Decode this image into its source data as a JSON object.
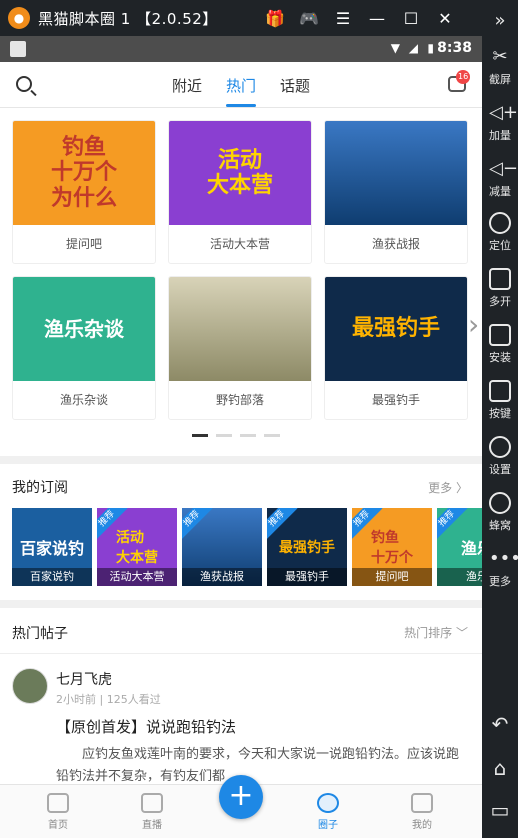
{
  "window": {
    "title": "黑猫脚本圈 1 【2.0.52】",
    "controls": [
      "☰",
      "—",
      "☐",
      "✕"
    ]
  },
  "sidebar": {
    "items": [
      {
        "label": "截屏",
        "icon": "scissors-icon"
      },
      {
        "label": "加量",
        "icon": "volume-up-icon"
      },
      {
        "label": "减量",
        "icon": "volume-down-icon"
      },
      {
        "label": "定位",
        "icon": "location-icon"
      },
      {
        "label": "多开",
        "icon": "multi-window-icon"
      },
      {
        "label": "安装",
        "icon": "apk-install-icon"
      },
      {
        "label": "按键",
        "icon": "keyboard-icon"
      },
      {
        "label": "设置",
        "icon": "gear-icon"
      },
      {
        "label": "蜂窝",
        "icon": "cellular-icon"
      },
      {
        "label": "更多",
        "icon": "more-icon"
      }
    ]
  },
  "statusbar": {
    "time": "8:38"
  },
  "topnav": {
    "tabs": [
      {
        "label": "附近"
      },
      {
        "label": "热门"
      },
      {
        "label": "话题"
      }
    ],
    "message_badge": "16"
  },
  "grid": {
    "cards": [
      {
        "label": "提问吧",
        "image_text": "钓鱼\n十万个\n为什么",
        "color": "#f59b23"
      },
      {
        "label": "活动大本营",
        "image_text": "活动\n大本营",
        "color": "#8a3fd1"
      },
      {
        "label": "渔获战报",
        "image_text": "",
        "color": "#1f5fa8"
      },
      {
        "label": "渔乐杂谈",
        "image_text": "渔乐杂谈",
        "color": "#2fb28f"
      },
      {
        "label": "野钓部落",
        "image_text": "",
        "color": "#b9b39a"
      },
      {
        "label": "最强钓手",
        "image_text": "最强钓手",
        "color": "#0f2a4a"
      }
    ]
  },
  "subscriptions": {
    "title": "我的订阅",
    "more": "更多 〉",
    "items": [
      {
        "caption": "百家说钓",
        "tag": "",
        "image_text": "百家说钓",
        "color": "#1b5fa0"
      },
      {
        "caption": "活动大本营",
        "tag": "推荐",
        "image_text": "活动\n大本营",
        "color": "#8a3fd1"
      },
      {
        "caption": "渔获战报",
        "tag": "推荐",
        "image_text": "",
        "color": "#2f6bb0"
      },
      {
        "caption": "最强钓手",
        "tag": "推荐",
        "image_text": "最强钓手",
        "color": "#0f2a4a"
      },
      {
        "caption": "提问吧",
        "tag": "推荐",
        "image_text": "钓鱼\n十万个",
        "color": "#f59b23"
      },
      {
        "caption": "渔乐",
        "tag": "推荐",
        "image_text": "渔乐",
        "color": "#2fb28f"
      }
    ]
  },
  "hot": {
    "title": "热门帖子",
    "sort": "热门排序 ﹀"
  },
  "post": {
    "author": "七月飞虎",
    "meta": "2小时前 | 125人看过",
    "title": "【原创首发】说说跑铅钓法",
    "body": "应钓友鱼戏莲叶南的要求，今天和大家说一说跑铅钓法。应该说跑铅钓法并不复杂，有钓友们都"
  },
  "bottomnav": {
    "items": [
      {
        "label": "首页"
      },
      {
        "label": "直播"
      },
      {
        "label": "圈子"
      },
      {
        "label": "我的"
      }
    ],
    "plus": "+"
  }
}
